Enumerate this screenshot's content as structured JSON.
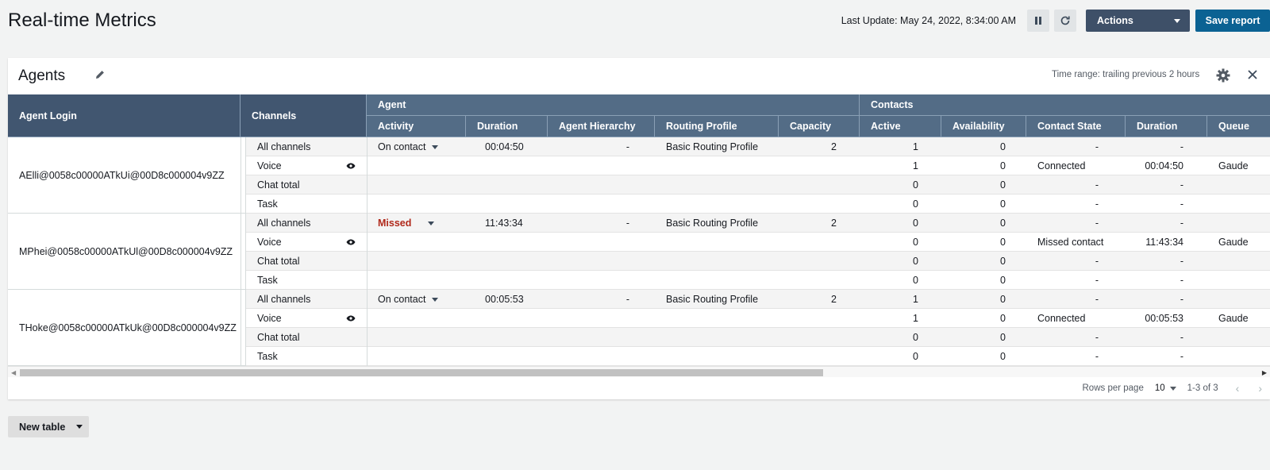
{
  "header": {
    "title": "Real-time Metrics",
    "last_update": "Last Update: May 24, 2022, 8:34:00 AM",
    "actions_label": "Actions",
    "save_label": "Save report"
  },
  "panel": {
    "title": "Agents",
    "time_range": "Time range: trailing previous 2 hours"
  },
  "table": {
    "col_agent_login": "Agent Login",
    "col_channels": "Channels",
    "group_agent": "Agent",
    "group_contacts": "Contacts",
    "subcols": [
      "Activity",
      "Duration",
      "Agent Hierarchy",
      "Routing Profile",
      "Capacity",
      "Active",
      "Availability",
      "Contact State",
      "Duration",
      "Queue"
    ],
    "agents": [
      {
        "login": "AElli@0058c00000ATkUi@00D8c000004v9ZZ",
        "rows": [
          {
            "channel": "All channels",
            "activity": "On contact",
            "duration": "00:04:50",
            "hierarchy": "-",
            "routing": "Basic Routing Profile",
            "capacity": "2",
            "active": "1",
            "availability": "0",
            "state": "-",
            "cduration": "-",
            "queue": ""
          },
          {
            "channel": "Voice",
            "active": "1",
            "availability": "0",
            "state": "Connected",
            "cduration": "00:04:50",
            "queue": "Gaude"
          },
          {
            "channel": "Chat total",
            "active": "0",
            "availability": "0",
            "state": "-",
            "cduration": "-",
            "queue": ""
          },
          {
            "channel": "Task",
            "active": "0",
            "availability": "0",
            "state": "-",
            "cduration": "-",
            "queue": ""
          }
        ]
      },
      {
        "login": "MPhei@0058c00000ATkUl@00D8c000004v9ZZ",
        "rows": [
          {
            "channel": "All channels",
            "activity": "Missed",
            "duration": "11:43:34",
            "hierarchy": "-",
            "routing": "Basic Routing Profile",
            "capacity": "2",
            "active": "0",
            "availability": "0",
            "state": "-",
            "cduration": "-",
            "queue": ""
          },
          {
            "channel": "Voice",
            "active": "0",
            "availability": "0",
            "state": "Missed contact",
            "cduration": "11:43:34",
            "queue": "Gaude"
          },
          {
            "channel": "Chat total",
            "active": "0",
            "availability": "0",
            "state": "-",
            "cduration": "-",
            "queue": ""
          },
          {
            "channel": "Task",
            "active": "0",
            "availability": "0",
            "state": "-",
            "cduration": "-",
            "queue": ""
          }
        ]
      },
      {
        "login": "THoke@0058c00000ATkUk@00D8c000004v9ZZ",
        "rows": [
          {
            "channel": "All channels",
            "activity": "On contact",
            "duration": "00:05:53",
            "hierarchy": "-",
            "routing": "Basic Routing Profile",
            "capacity": "2",
            "active": "1",
            "availability": "0",
            "state": "-",
            "cduration": "-",
            "queue": ""
          },
          {
            "channel": "Voice",
            "active": "1",
            "availability": "0",
            "state": "Connected",
            "cduration": "00:05:53",
            "queue": "Gaude"
          },
          {
            "channel": "Chat total",
            "active": "0",
            "availability": "0",
            "state": "-",
            "cduration": "-",
            "queue": ""
          },
          {
            "channel": "Task",
            "active": "0",
            "availability": "0",
            "state": "-",
            "cduration": "-",
            "queue": ""
          }
        ]
      }
    ]
  },
  "pagination": {
    "rows_per_page_label": "Rows per page",
    "rows_per_page": "10",
    "range": "1-3 of 3"
  },
  "new_table_label": "New table",
  "colors": {
    "header_dark": "#415670",
    "header": "#536c86",
    "actions_button": "#3e5068",
    "save_button": "#0b6293",
    "missed_text": "#b0281a"
  }
}
